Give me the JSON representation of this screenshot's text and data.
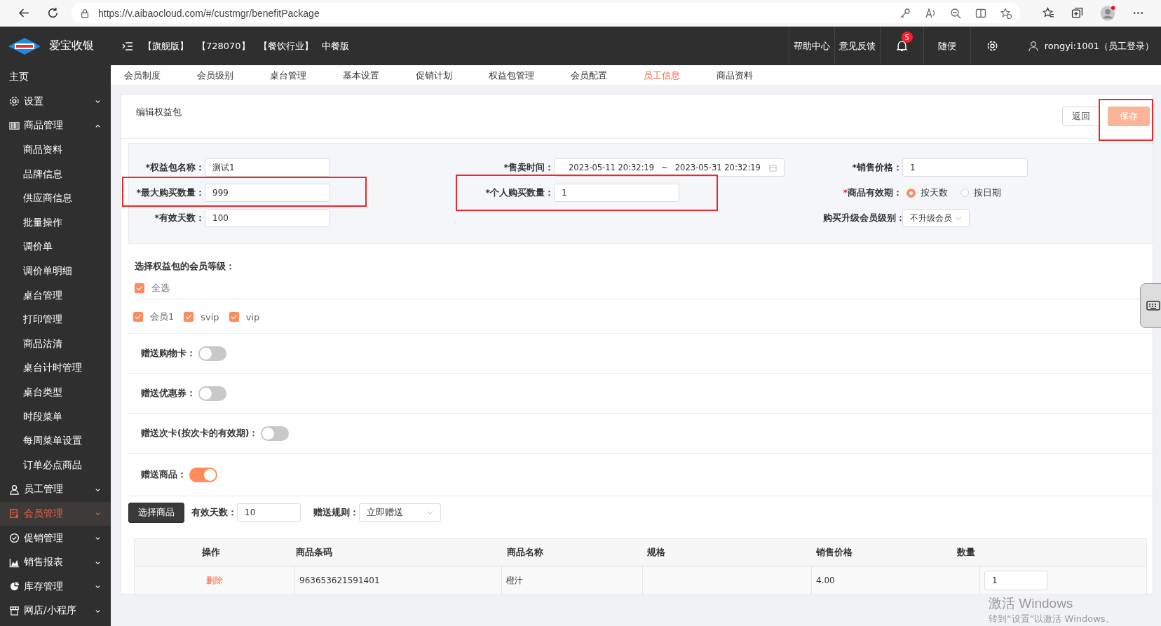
{
  "browser": {
    "url": "https://v.aibaocloud.com/#/custmgr/benefitPackage"
  },
  "header": {
    "brand": "爱宝收银",
    "tags": [
      "【旗舰版】",
      "【728070】",
      "【餐饮行业】",
      "中餐版"
    ],
    "links": [
      "帮助中心",
      "意见反馈"
    ],
    "notification_count": "5",
    "shop": "随便",
    "user": "rongyi:1001（员工登录）"
  },
  "sidebar": [
    {
      "label": "主页",
      "kind": "link",
      "selected": false
    },
    {
      "label": "设置",
      "kind": "group",
      "expanded": false,
      "selected": false
    },
    {
      "label": "商品管理",
      "kind": "group",
      "expanded": true,
      "selected": false,
      "children": [
        {
          "label": "商品资料",
          "selected": false
        },
        {
          "label": "品牌信息",
          "selected": false
        },
        {
          "label": "供应商信息",
          "selected": false
        },
        {
          "label": "批量操作",
          "selected": false
        },
        {
          "label": "调价单",
          "selected": false
        },
        {
          "label": "调价单明细",
          "selected": false
        },
        {
          "label": "桌台管理",
          "selected": false
        },
        {
          "label": "打印管理",
          "selected": false
        },
        {
          "label": "商品沽清",
          "selected": false
        },
        {
          "label": "桌台计时管理",
          "selected": false
        },
        {
          "label": "桌台类型",
          "selected": false
        },
        {
          "label": "时段菜单",
          "selected": false
        },
        {
          "label": "每周菜单设置",
          "selected": false
        },
        {
          "label": "订单必点商品",
          "selected": false
        }
      ]
    },
    {
      "label": "员工管理",
      "kind": "group",
      "expanded": false,
      "selected": false
    },
    {
      "label": "会员管理",
      "kind": "group",
      "expanded": false,
      "selected": true
    },
    {
      "label": "促销管理",
      "kind": "group",
      "expanded": false,
      "selected": false
    },
    {
      "label": "销售报表",
      "kind": "group",
      "expanded": false,
      "selected": false
    },
    {
      "label": "库存管理",
      "kind": "group",
      "expanded": false,
      "selected": false
    },
    {
      "label": "网店/小程序",
      "kind": "group",
      "expanded": false,
      "selected": false
    }
  ],
  "tabs": [
    {
      "label": "会员制度",
      "selected": false
    },
    {
      "label": "会员级别",
      "selected": false
    },
    {
      "label": "桌台管理",
      "selected": false
    },
    {
      "label": "基本设置",
      "selected": false
    },
    {
      "label": "促销计划",
      "selected": false
    },
    {
      "label": "权益包管理",
      "selected": false
    },
    {
      "label": "会员配置",
      "selected": false
    },
    {
      "label": "员工信息",
      "selected": true
    },
    {
      "label": "商品资料",
      "selected": false
    }
  ],
  "panel": {
    "title": "编辑权益包",
    "buttons": [
      {
        "label": "返回",
        "kind": "default",
        "highlighted": false
      },
      {
        "label": "保存",
        "kind": "primary",
        "highlighted": true
      }
    ]
  },
  "form": {
    "columns": [
      [
        {
          "kind": "text",
          "mark": "*",
          "mark_red": false,
          "label": "权益包名称：",
          "value": "测试1",
          "highlighted": false
        },
        {
          "kind": "text",
          "mark": "*",
          "mark_red": false,
          "label": "最大购买数量：",
          "value": "999",
          "highlighted": true
        },
        {
          "kind": "text",
          "mark": "*",
          "mark_red": false,
          "label": "有效天数：",
          "value": "100",
          "highlighted": false
        }
      ],
      [
        {
          "kind": "daterange",
          "mark": "*",
          "mark_red": false,
          "label": "售卖时间：",
          "start": "2023-05-11 20:32:19",
          "separator": "~",
          "end": "2023-05-31 20:32:19",
          "highlighted": false
        },
        {
          "kind": "text",
          "mark": "*",
          "mark_red": false,
          "label": "个人购买数量：",
          "value": "1",
          "highlighted": true
        }
      ],
      [
        {
          "kind": "text",
          "mark": "*",
          "mark_red": false,
          "label": "销售价格：",
          "value": "1",
          "highlighted": false
        },
        {
          "kind": "radio",
          "mark": "*",
          "mark_red": true,
          "label": "商品有效期：",
          "options": [
            {
              "label": "按天数",
              "selected": true
            },
            {
              "label": "按日期",
              "selected": false
            }
          ],
          "highlighted": false
        },
        {
          "kind": "select",
          "label": "购买升级会员级别：",
          "value": "不升级会员",
          "highlighted": false
        }
      ]
    ]
  },
  "levels": {
    "title": "选择权益包的会员等级：",
    "select_all": {
      "label": "全选",
      "checked": true
    },
    "items": [
      {
        "label": "会员1",
        "checked": true
      },
      {
        "label": "svip",
        "checked": true
      },
      {
        "label": "vip",
        "checked": true
      }
    ]
  },
  "toggles": [
    {
      "label": "赠送购物卡：",
      "on": false
    },
    {
      "label": "赠送优惠券：",
      "on": false
    },
    {
      "label": "赠送次卡(按次卡的有效期)：",
      "on": false
    },
    {
      "label": "赠送商品：",
      "on": true
    }
  ],
  "gift": {
    "button": "选择商品",
    "days_label": "有效天数：",
    "days": "10",
    "rule_label": "赠送规则：",
    "rule": "立即赠送"
  },
  "table": {
    "columns": [
      "操作",
      "商品条码",
      "商品名称",
      "规格",
      "销售价格",
      "数量"
    ],
    "rows": [
      {
        "action": "删除",
        "barcode": "963653621591401",
        "name": "橙汁",
        "price": "4.00",
        "quantity": "1"
      }
    ]
  },
  "activation": {
    "title": "激活 Windows",
    "hint": "转到“设置”以激活 Windows。"
  }
}
